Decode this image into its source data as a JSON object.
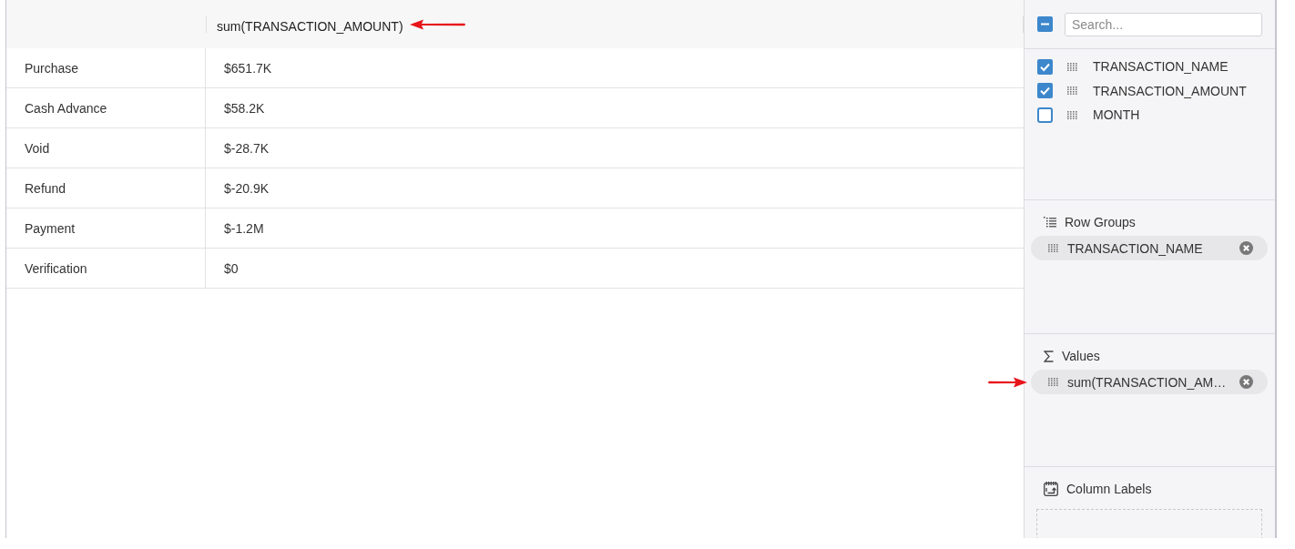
{
  "table": {
    "value_column": {
      "label": "sum(TRANSACTION_AMOUNT)",
      "arrow": true
    },
    "rows": [
      {
        "label": "Purchase",
        "value": "$651.7K"
      },
      {
        "label": "Cash Advance",
        "value": "$58.2K"
      },
      {
        "label": "Void",
        "value": "$-28.7K"
      },
      {
        "label": "Refund",
        "value": "$-20.9K"
      },
      {
        "label": "Payment",
        "value": "$-1.2M"
      },
      {
        "label": "Verification",
        "value": "$0"
      }
    ]
  },
  "panel": {
    "select_all": {
      "indeterminate": true
    },
    "search": {
      "placeholder": "Search..."
    },
    "fields": [
      {
        "label": "TRANSACTION_NAME",
        "checked": true
      },
      {
        "label": "TRANSACTION_AMOUNT",
        "checked": true
      },
      {
        "label": "MONTH",
        "checked": false
      }
    ],
    "sections": [
      {
        "kind": "row_groups",
        "title": "Row Groups",
        "chips": [
          {
            "label": "TRANSACTION_NAME",
            "arrow": false
          }
        ]
      },
      {
        "kind": "values",
        "title": "Values",
        "chips": [
          {
            "label": "sum(TRANSACTION_AM…",
            "arrow": true
          }
        ]
      },
      {
        "kind": "column_labels",
        "title": "Column Labels"
      }
    ]
  }
}
